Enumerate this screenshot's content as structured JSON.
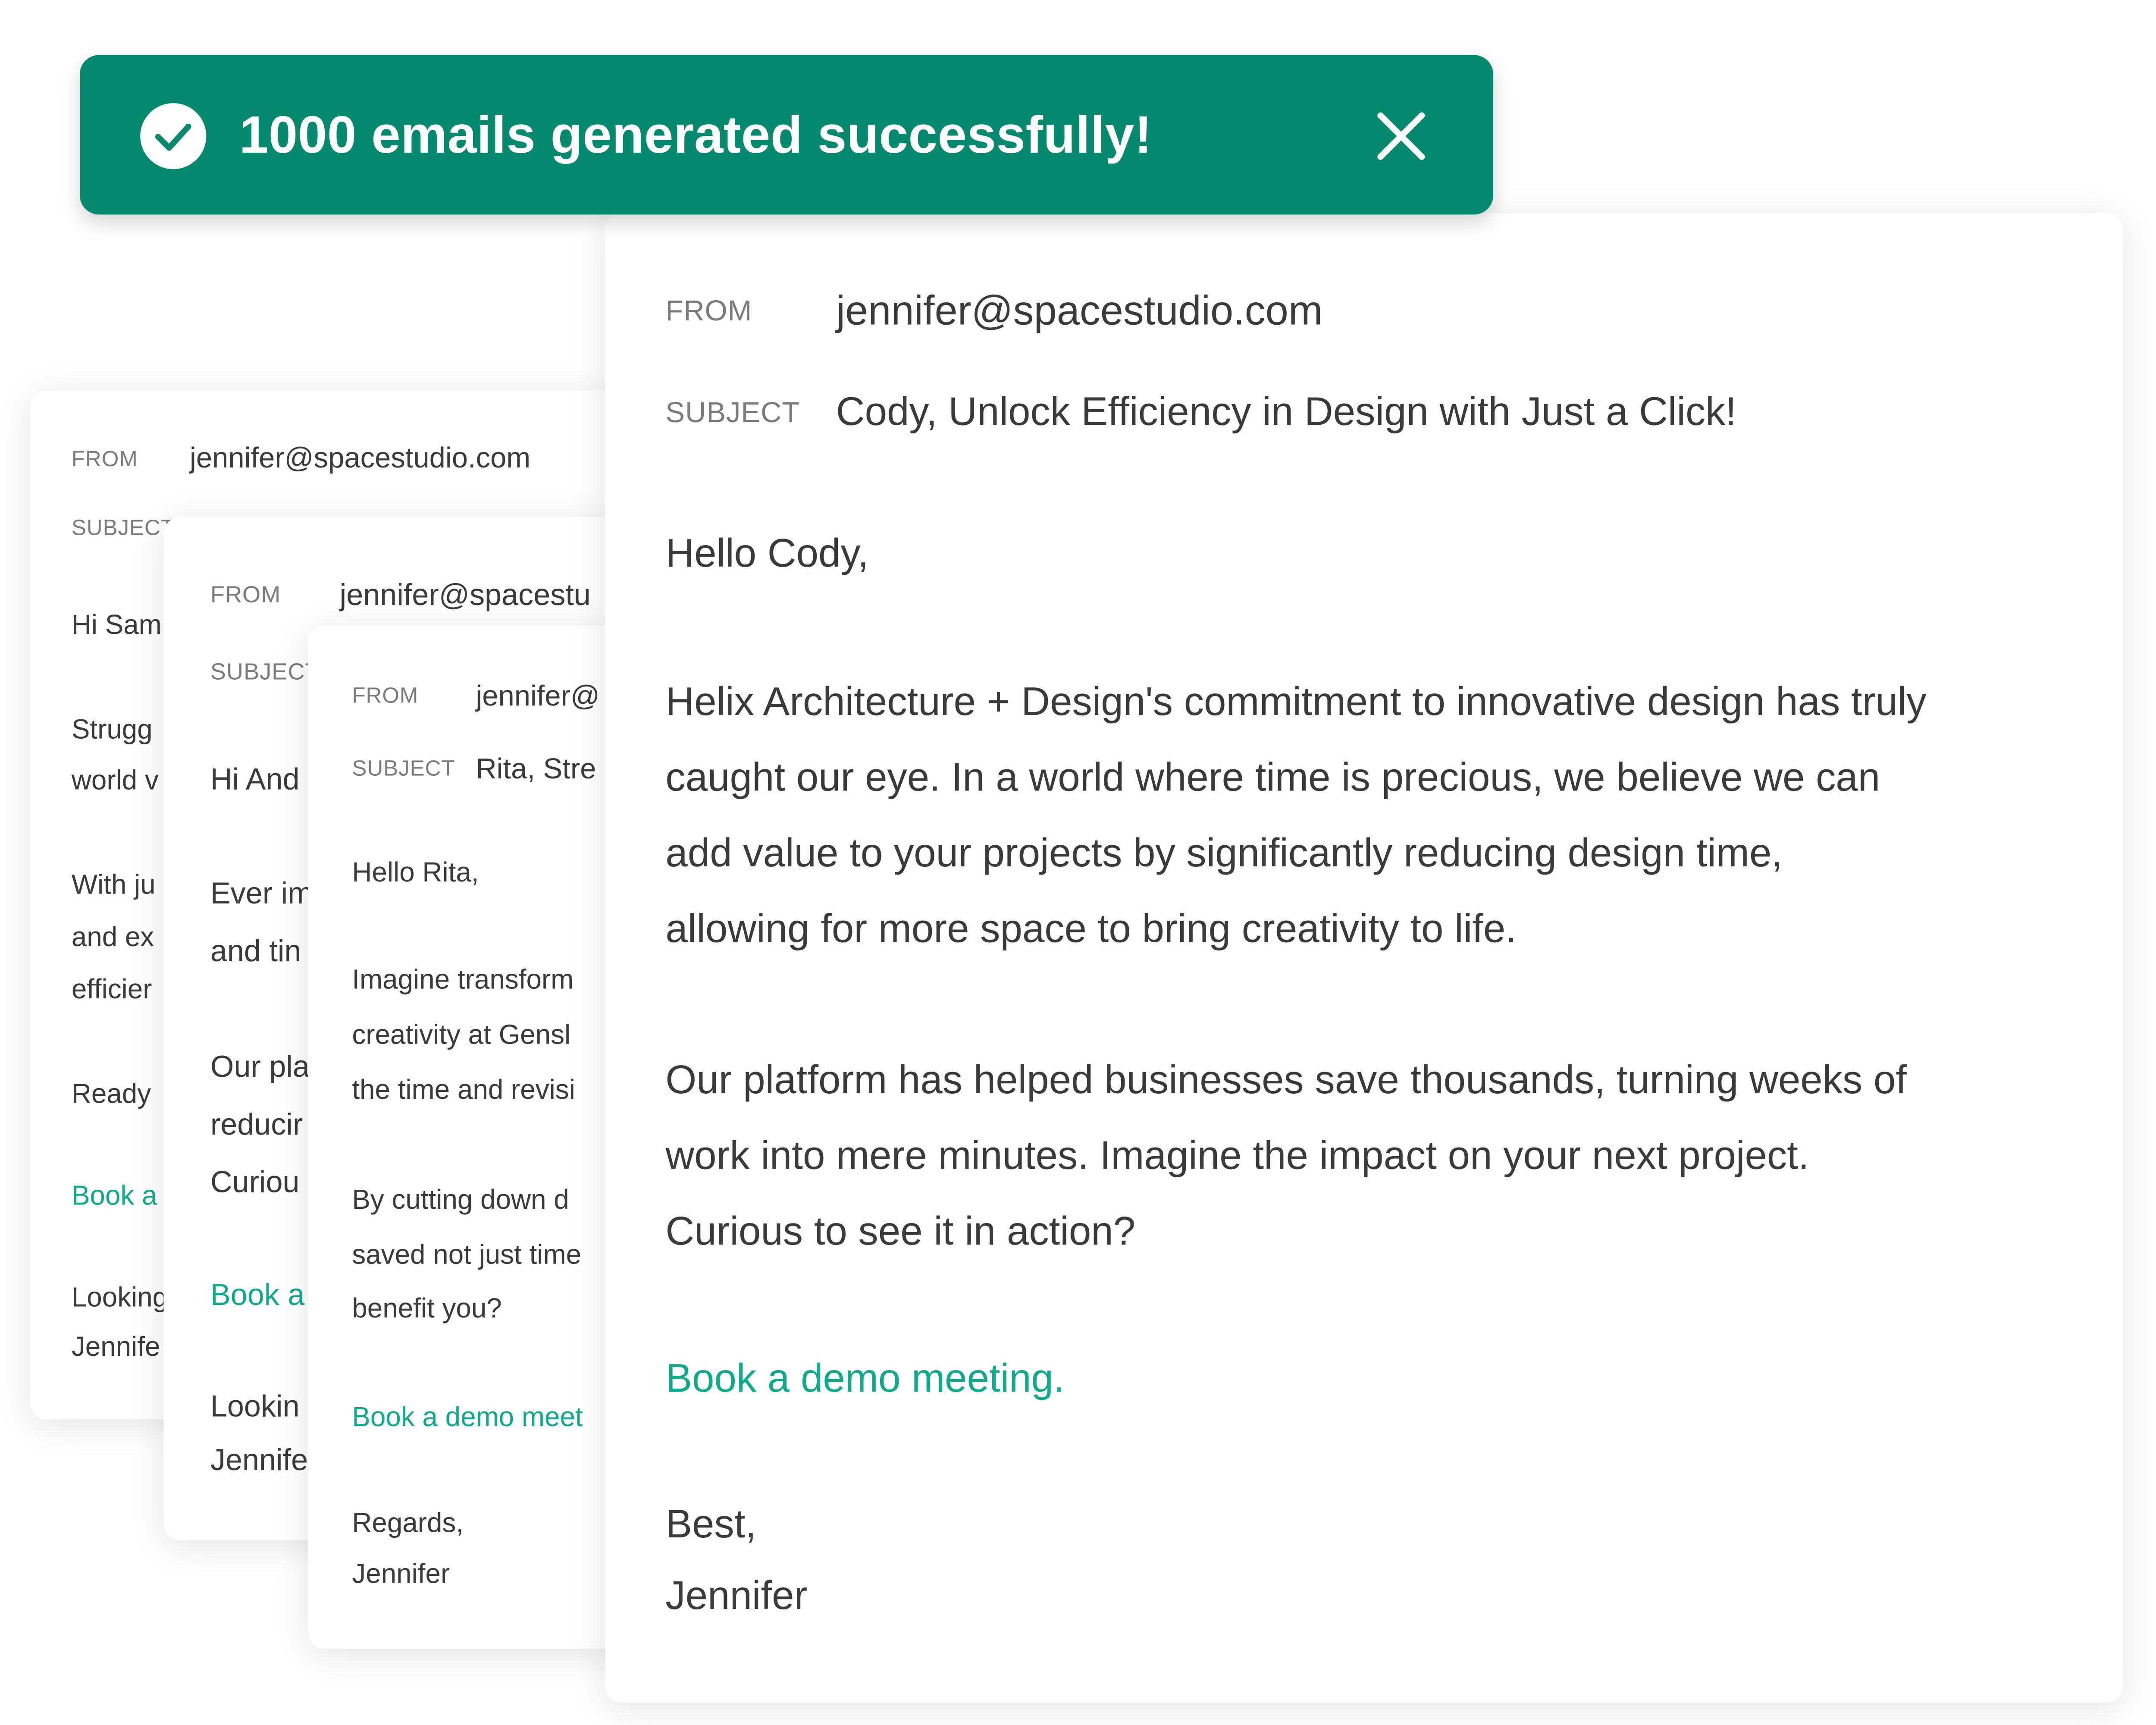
{
  "toast": {
    "message": "1000 emails generated successfully!",
    "check_icon": "check-circle-icon",
    "close_icon": "close-icon",
    "background": "#06896f"
  },
  "colors": {
    "link": "#11a98b",
    "text": "#3a3a3a",
    "label": "#7b7b7b"
  },
  "emails": [
    {
      "from_label": "FROM",
      "from": "jennifer@spacestudio.com",
      "subject_label": "SUBJECT",
      "subject": "",
      "greeting": "Hi Sam",
      "body": [
        "Strugg",
        "world v",
        "With ju",
        "and ex",
        "efficier",
        "Ready"
      ],
      "cta": "Book a",
      "closing": "Looking",
      "signature": "Jennife"
    },
    {
      "from_label": "FROM",
      "from": "jennifer@spacestu",
      "subject_label": "SUBJECT",
      "subject": "",
      "greeting": "Hi And",
      "body": [
        "Ever im",
        "and tin",
        "Our pla",
        "reducir",
        "Curiou"
      ],
      "cta": "Book a",
      "closing": "Lookin",
      "signature": "Jennife"
    },
    {
      "from_label": "FROM",
      "from": "jennifer@",
      "subject_label": "SUBJECT",
      "subject": "Rita, Stre",
      "greeting": "Hello Rita,",
      "body": [
        "Imagine transform",
        "creativity at Gensl",
        "the time and revisi",
        "By cutting down d",
        "saved not just time",
        "benefit you?"
      ],
      "cta": "Book a demo meet",
      "closing": "Regards,",
      "signature": "Jennifer"
    },
    {
      "from_label": "FROM",
      "from": "jennifer@spacestudio.com",
      "subject_label": "SUBJECT",
      "subject": "Cody, Unlock Efficiency in Design with Just a Click!",
      "greeting": "Hello Cody,",
      "paragraph1": [
        "Helix Architecture + Design's commitment to innovative design has truly",
        "caught our eye. In a world where time is precious, we believe we can",
        "add value to your projects by significantly reducing design time,",
        "allowing for more space to bring creativity to life."
      ],
      "paragraph2": [
        "Our platform has helped businesses save thousands, turning weeks of",
        "work into mere minutes. Imagine the impact on your next project.",
        "Curious to see it in action?"
      ],
      "cta": "Book a demo meeting.",
      "closing": "Best,",
      "signature": "Jennifer"
    }
  ]
}
